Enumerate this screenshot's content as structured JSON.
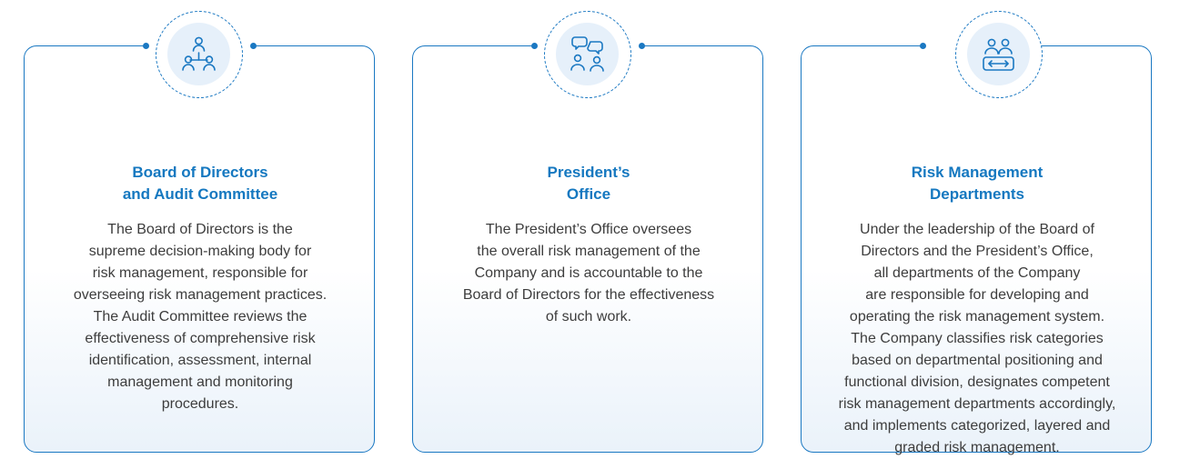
{
  "cards": [
    {
      "icon": "organization-hierarchy-icon",
      "title": "Board of Directors\nand Audit Committee",
      "body": "The Board of Directors is the\nsupreme decision-making body for\nrisk management, responsible for\noverseeing risk management practices.\nThe Audit Committee reviews the\neffectiveness of comprehensive risk\nidentification, assessment, internal\nmanagement and monitoring\nprocedures."
    },
    {
      "icon": "discussion-people-icon",
      "title": "President’s\nOffice",
      "body": "The President’s Office oversees\nthe overall risk management of the\nCompany and is accountable to the\nBoard of Directors for the effectiveness\nof such work."
    },
    {
      "icon": "people-exchange-icon",
      "title": "Risk Management\nDepartments",
      "body": "Under the leadership of the Board of\nDirectors and the President’s Office,\nall departments of the Company\nare responsible for developing and\noperating the risk management system.\nThe Company classifies risk categories\nbased on departmental positioning and\nfunctional division, designates competent\nrisk management departments accordingly,\nand implements categorized, layered and\ngraded risk management."
    }
  ],
  "colors": {
    "accent": "#1578c0",
    "border": "#1a78c2",
    "icon_bg": "#e6f0fa",
    "text": "#3d3d3d"
  }
}
